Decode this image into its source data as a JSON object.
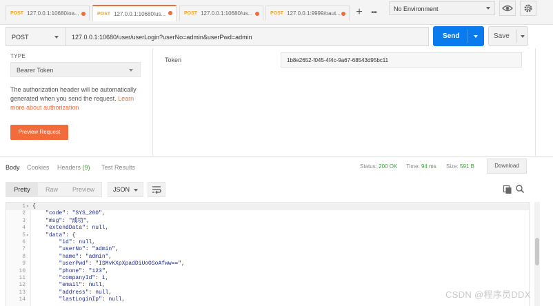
{
  "tabs": [
    {
      "method": "POST",
      "label": "127.0.0.1:10680/oa..."
    },
    {
      "method": "POST",
      "label": "127.0.0.1:10680/us..."
    },
    {
      "method": "POST",
      "label": "127.0.0.1:10680/us..."
    },
    {
      "method": "POST",
      "label": "127.0.0.1:9999/oaut..."
    }
  ],
  "environment": {
    "selected": "No Environment"
  },
  "request": {
    "method": "POST",
    "url": "127.0.0.1:10680/user/userLogin?userNo=admin&userPwd=admin",
    "send_label": "Send",
    "save_label": "Save"
  },
  "auth": {
    "type_label": "TYPE",
    "type_value": "Bearer Token",
    "help_text": "The authorization header will be automatically generated when you send the request. ",
    "learn_more": "Learn more about authorization",
    "preview_button": "Preview Request",
    "token_label": "Token",
    "token_value": "1b8e2652-f045-4f4c-9a67-68543d95bc11"
  },
  "response": {
    "tabs": [
      "Body",
      "Cookies",
      "Headers",
      "Test Results"
    ],
    "headers_count": "(9)",
    "status_label": "Status:",
    "status_value": "200 OK",
    "time_label": "Time:",
    "time_value": "94 ms",
    "size_label": "Size:",
    "size_value": "591 B",
    "download_label": "Download",
    "view_modes": [
      "Pretty",
      "Raw",
      "Preview"
    ],
    "format": "JSON"
  },
  "code_lines": [
    {
      "n": "1",
      "fold": "▾",
      "text": "{"
    },
    {
      "n": "2",
      "fold": "",
      "text": "    \"code\": \"SYS_200\","
    },
    {
      "n": "3",
      "fold": "",
      "text": "    \"msg\": \"成功\","
    },
    {
      "n": "4",
      "fold": "",
      "text": "    \"extendData\": null,"
    },
    {
      "n": "5",
      "fold": "▾",
      "text": "    \"data\": {"
    },
    {
      "n": "6",
      "fold": "",
      "text": "        \"id\": null,"
    },
    {
      "n": "7",
      "fold": "",
      "text": "        \"userNo\": \"admin\","
    },
    {
      "n": "8",
      "fold": "",
      "text": "        \"name\": \"admin\","
    },
    {
      "n": "9",
      "fold": "",
      "text": "        \"userPwd\": \"ISMvKXpXpadDiUoOSoAfww==\","
    },
    {
      "n": "10",
      "fold": "",
      "text": "        \"phone\": \"123\","
    },
    {
      "n": "11",
      "fold": "",
      "text": "        \"companyId\": 1,"
    },
    {
      "n": "12",
      "fold": "",
      "text": "        \"email\": null,"
    },
    {
      "n": "13",
      "fold": "",
      "text": "        \"address\": null,"
    },
    {
      "n": "14",
      "fold": "",
      "text": "        \"lastLoginIp\": null,"
    }
  ],
  "watermark": "CSDN @程序员DDX",
  "colors": {
    "accent": "#f26b3a",
    "send": "#097bed",
    "status_ok": "#3fa33f"
  }
}
